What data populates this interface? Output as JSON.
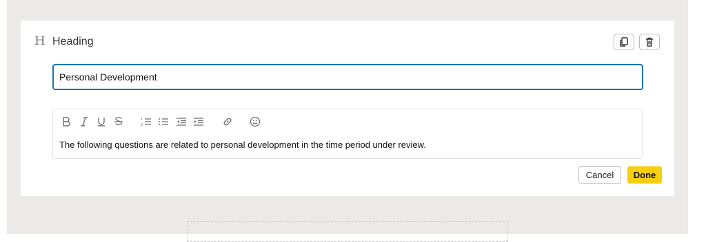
{
  "block": {
    "icon": "heading-icon",
    "icon_glyph": "H",
    "title": "Heading",
    "actions": {
      "copy_icon": "copy-icon",
      "delete_icon": "trash-icon"
    }
  },
  "title_input": {
    "value": "Personal Development"
  },
  "editor": {
    "toolbar": [
      "bold",
      "italic",
      "underline",
      "strikethrough",
      "ordered-list",
      "bullet-list",
      "outdent",
      "indent",
      "link",
      "emoji"
    ],
    "body": "The following questions are related to personal development in the time period under review."
  },
  "buttons": {
    "cancel": "Cancel",
    "done": "Done"
  },
  "colors": {
    "accent_border": "#1a73b6",
    "done_bg": "#f7cf0f",
    "canvas_bg": "#ebeae8"
  }
}
